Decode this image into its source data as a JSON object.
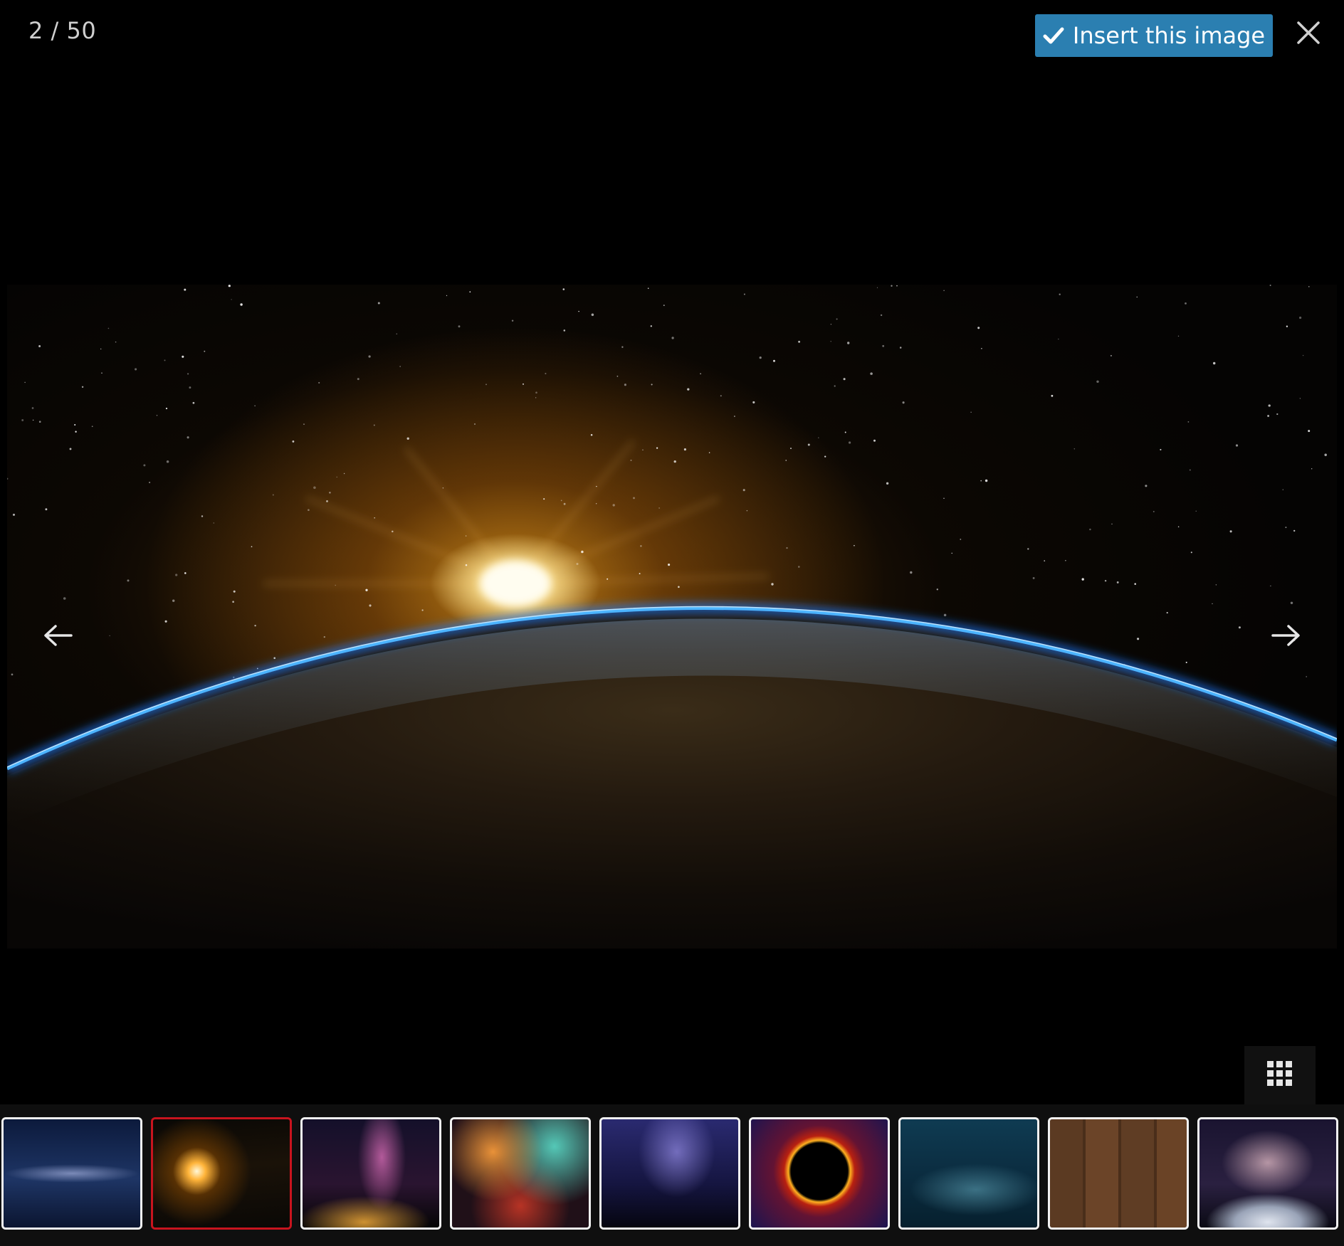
{
  "viewer": {
    "counter": "2 / 50",
    "insert_label": "Insert this image",
    "current_index": 2,
    "total": 50
  },
  "icons": {
    "insert": "check-icon",
    "close": "close-icon",
    "prev": "arrow-left-icon",
    "next": "arrow-right-icon",
    "grid": "grid-icon"
  },
  "colors": {
    "insert_button": "#2b7fb1",
    "active_thumb_border": "#c8141e",
    "thumb_border": "#f2f2f2"
  },
  "thumbnails": [
    {
      "subject": "milky-way-night-sky",
      "active": false
    },
    {
      "subject": "sunrise-over-earth",
      "active": true
    },
    {
      "subject": "milky-way-silhouette",
      "active": false
    },
    {
      "subject": "colorful-nebula",
      "active": false
    },
    {
      "subject": "starry-sky-trees",
      "active": false
    },
    {
      "subject": "solar-eclipse-ring",
      "active": false
    },
    {
      "subject": "teal-night-sky",
      "active": false
    },
    {
      "subject": "christmas-wood-table",
      "active": false
    },
    {
      "subject": "galaxy-over-planet",
      "active": false
    }
  ]
}
